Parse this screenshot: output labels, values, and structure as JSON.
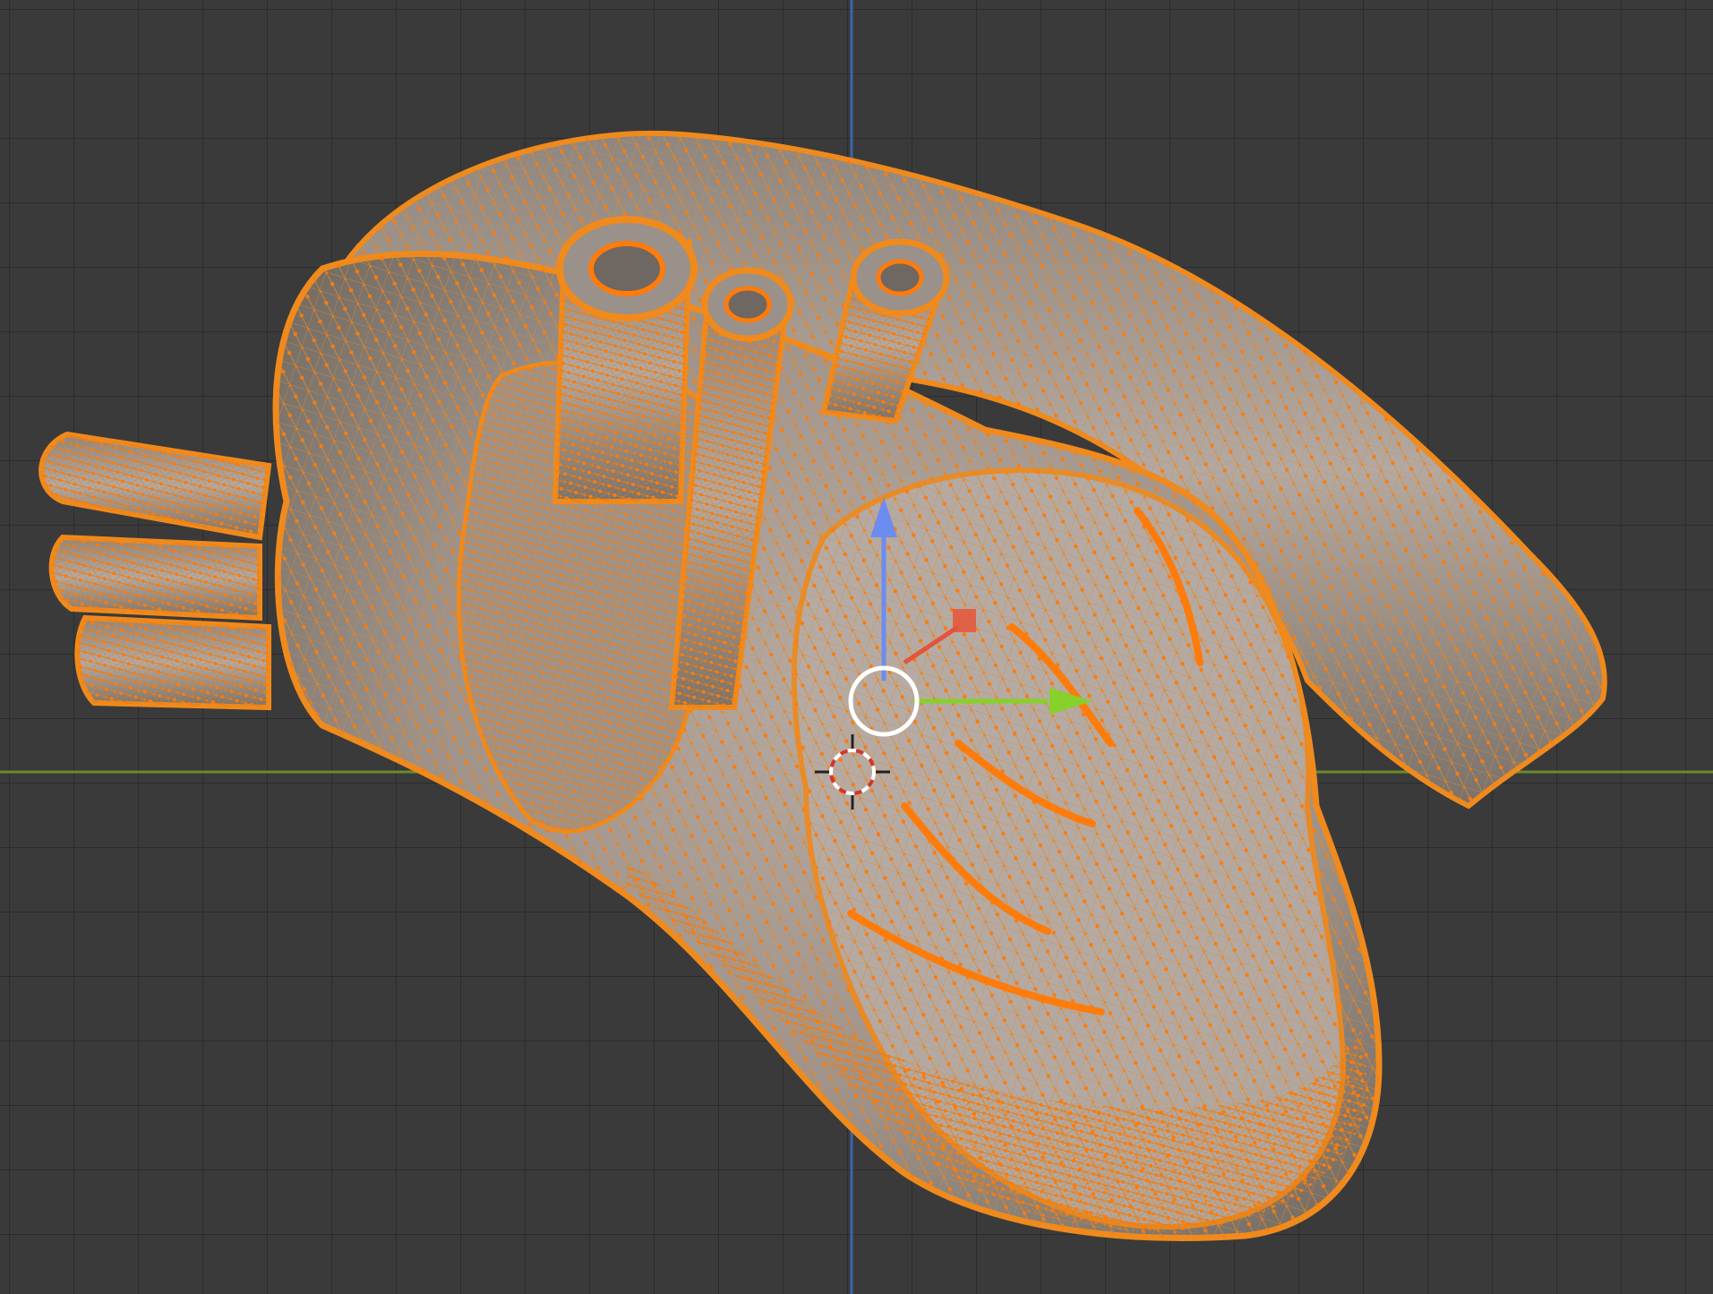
{
  "viewport": {
    "mode": "edit-mode",
    "shading": "solid-with-wireframe-overlay",
    "view": "orthographic",
    "object": "heart-mesh",
    "selection": "all-vertices-selected"
  },
  "colors": {
    "background": "#3a3a3a",
    "grid_line": "#2b2b2b",
    "x_axis_line": "#6b8a2a",
    "z_axis_line": "#3f64a3",
    "mesh_surface": "#a49a93",
    "mesh_shadow": "#7d746e",
    "selected_edge": "#e98012",
    "selected_vertex": "#ff7b0a",
    "gizmo_z": "#6c8cf0",
    "gizmo_y": "#86d12a",
    "gizmo_x": "#e6533a",
    "pivot_ring": "#ffffff",
    "cursor_red": "#d8332a"
  },
  "gizmo": {
    "arrows": [
      "z-arrow-icon",
      "y-arrow-icon",
      "x-handle-icon"
    ],
    "center": "transform-pivot-icon"
  },
  "cursor": {
    "icon": "3d-cursor-icon"
  }
}
